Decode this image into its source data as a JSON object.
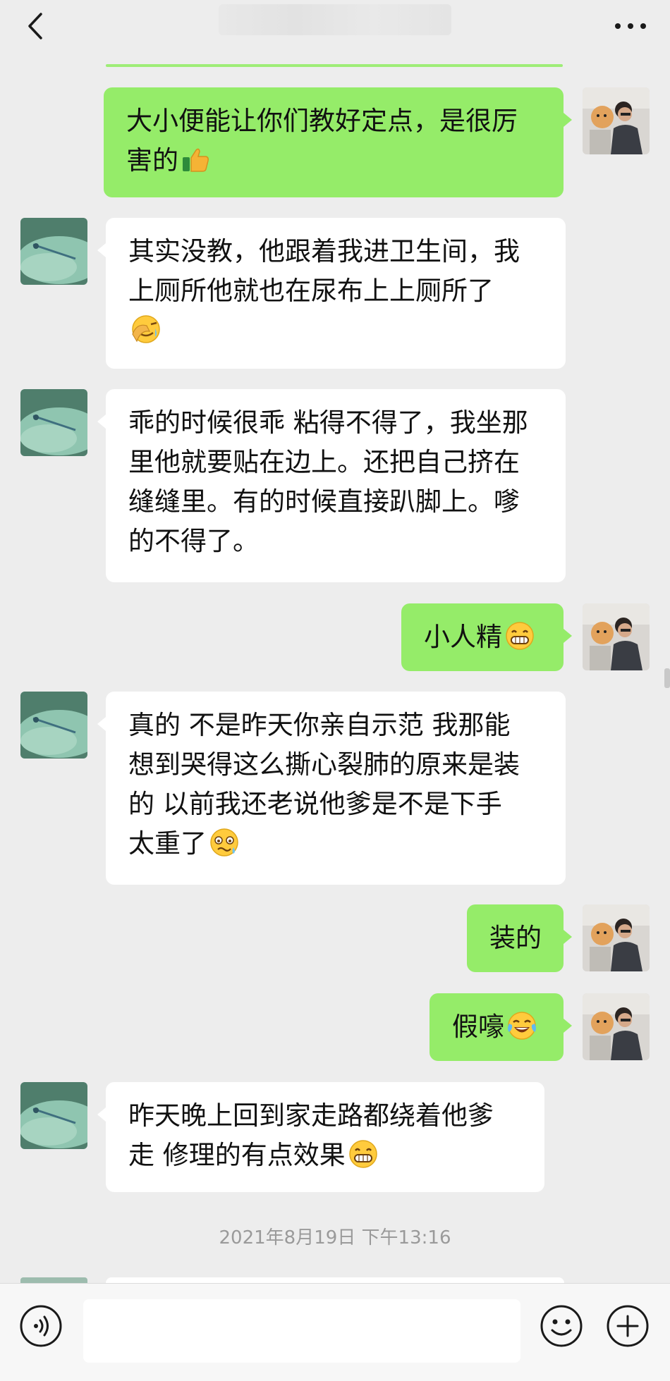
{
  "header": {
    "back_icon": "chevron-left-icon",
    "more_icon": "ellipsis-icon"
  },
  "messages": [
    {
      "side": "me",
      "text": "大小便能让你们教好定点，是很厉\n害的",
      "emoji": "thumbs-up"
    },
    {
      "side": "other",
      "text": "其实没教，他跟着我进卫生间，我\n上厕所他就也在尿布上上厕所了\n",
      "emoji": "facepalm"
    },
    {
      "side": "other",
      "text": "乖的时候很乖 粘得不得了，我坐那\n里他就要贴在边上。还把自己挤在\n缝缝里。有的时候直接趴脚上。嗲\n的不得了。",
      "emoji": ""
    },
    {
      "side": "me",
      "text": "小人精",
      "emoji": "grin"
    },
    {
      "side": "other",
      "text": "真的 不是昨天你亲自示范 我那能\n想到哭得这么撕心裂肺的原来是装\n的 以前我还老说他爹是不是下手\n太重了",
      "emoji": "woozy"
    },
    {
      "side": "me",
      "text": "装的",
      "emoji": ""
    },
    {
      "side": "me",
      "text": "假嚎",
      "emoji": "tears-of-joy"
    },
    {
      "side": "other",
      "text": "昨天晚上回到家走路都绕着他爹\n走 修理的有点效果",
      "emoji": "grin"
    }
  ],
  "timestamp": "2021年8月19日 下午13:16",
  "bottom": {
    "voice_icon": "voice-icon",
    "emoji_icon": "smiley-icon",
    "plus_icon": "plus-icon"
  },
  "colors": {
    "background": "#ededed",
    "bubble_me": "#95ec69",
    "bubble_other": "#ffffff"
  }
}
